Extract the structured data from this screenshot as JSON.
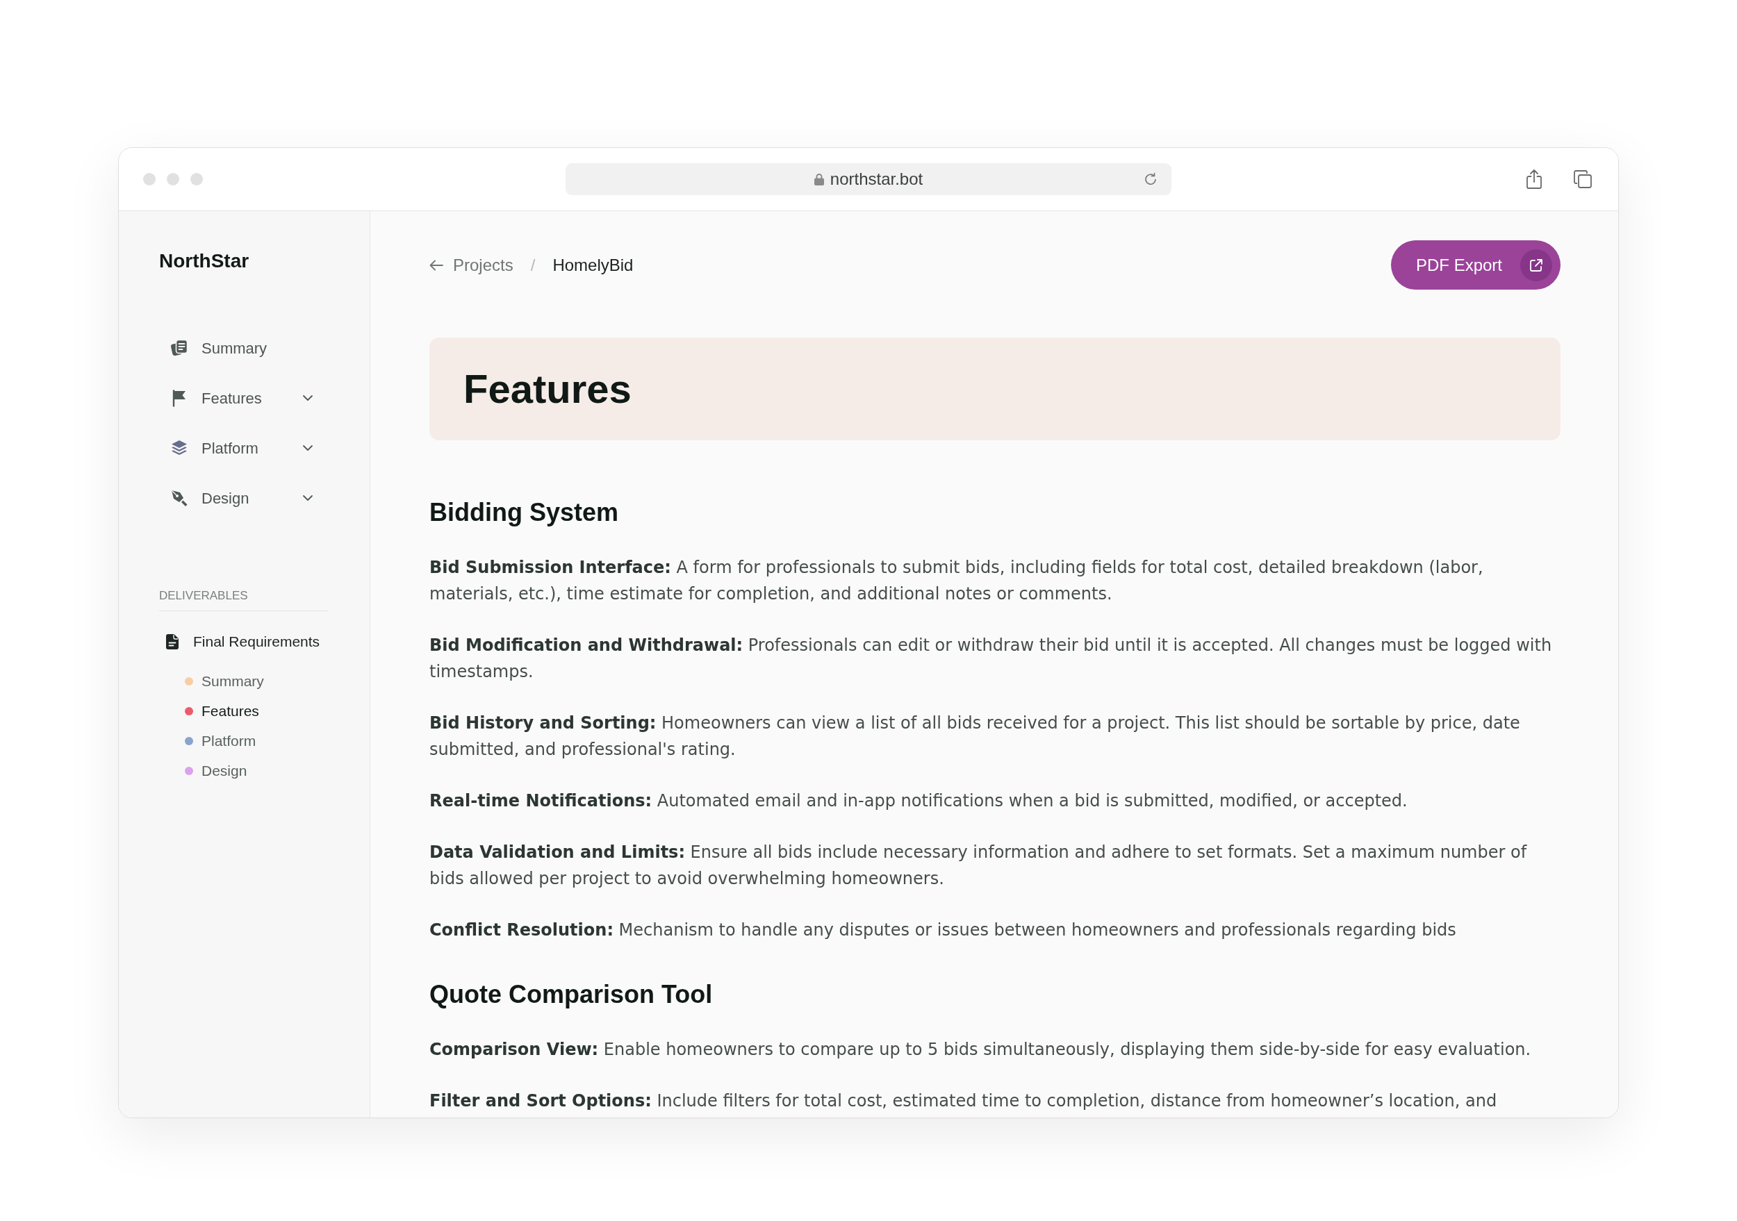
{
  "browser": {
    "url": "northstar.bot"
  },
  "sidebar": {
    "logo": "NorthStar",
    "nav": [
      {
        "label": "Summary",
        "kind": "link"
      },
      {
        "label": "Features",
        "kind": "group"
      },
      {
        "label": "Platform",
        "kind": "group"
      },
      {
        "label": "Design",
        "kind": "group"
      }
    ],
    "section_title": "DELIVERABLES",
    "document": {
      "title": "Final Requirements",
      "children": [
        {
          "label": "Summary",
          "color": "#f9cda4",
          "selected": false
        },
        {
          "label": "Features",
          "color": "#ec5b6c",
          "selected": true
        },
        {
          "label": "Platform",
          "color": "#8aa3cb",
          "selected": false
        },
        {
          "label": "Design",
          "color": "#dba2ec",
          "selected": false
        }
      ]
    }
  },
  "breadcrumb": {
    "back": "Projects",
    "separator": "/",
    "current": "HomelyBid"
  },
  "export_button": {
    "label": "PDF Export"
  },
  "page_title": "Features",
  "sections": [
    {
      "heading": "Bidding System",
      "items": [
        "**Bid Submission Interface:** A form for professionals to submit bids, including fields for total cost, detailed breakdown (labor, materials, etc.), time estimate for completion, and additional notes or comments.",
        "**Bid Modification and Withdrawal:** Professionals can edit or withdraw their bid until it is accepted. All changes must be logged with timestamps.",
        "**Bid History and Sorting:** Homeowners can view a list of all bids received for a project. This list should be sortable by price, date submitted, and professional's rating.",
        "**Real-time Notifications:** Automated email and in-app notifications when a bid is submitted, modified, or accepted.",
        "**Data Validation and Limits:** Ensure all bids include necessary information and adhere to set formats. Set a maximum number of bids allowed per project to avoid overwhelming homeowners.",
        "**Conflict Resolution:** Mechanism to handle any disputes or issues between homeowners and professionals regarding bids"
      ]
    },
    {
      "heading": "Quote Comparison Tool",
      "items": [
        "**Comparison View:** Enable homeowners to compare up to 5 bids simultaneously, displaying them side-by-side for easy evaluation.",
        "**Filter and Sort Options:** Include filters for total cost, estimated time to completion, distance from homeowner’s location, and"
      ]
    }
  ]
}
